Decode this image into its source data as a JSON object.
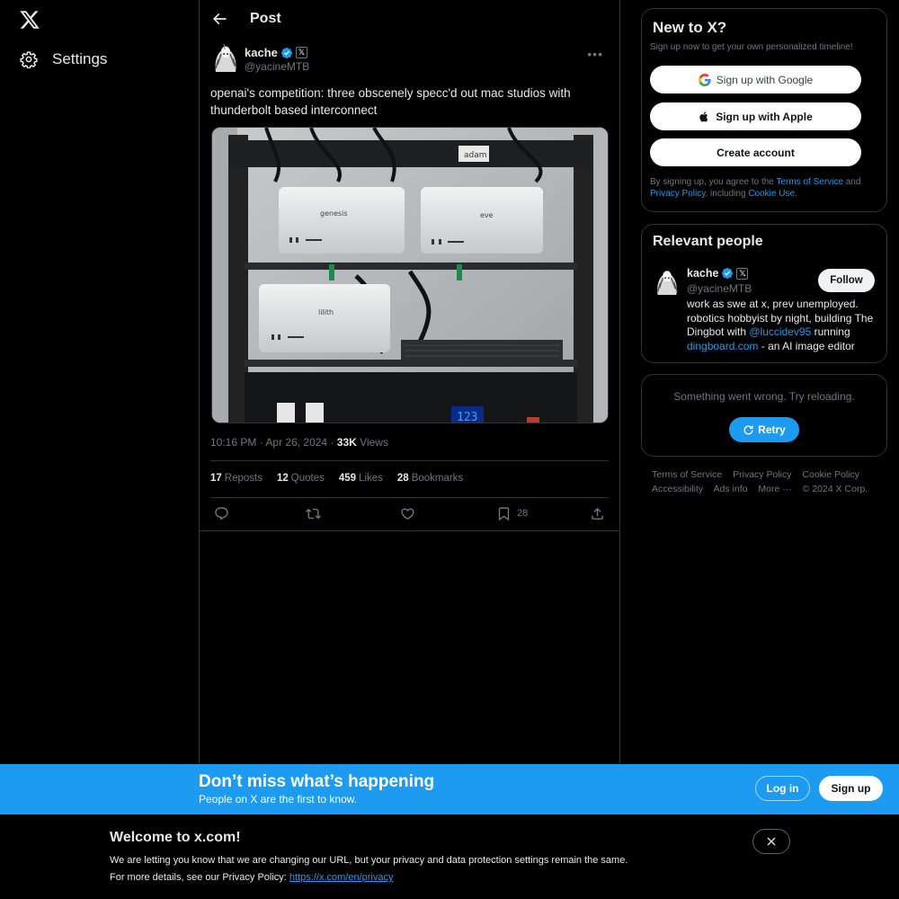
{
  "nav": {
    "logo_icon": "x-logo-icon",
    "settings_label": "Settings"
  },
  "header": {
    "title": "Post"
  },
  "post": {
    "author_name": "kache",
    "author_handle": "@yacineMTB",
    "author_badge": "𝕏",
    "text": "openai's competition: three obscenely specc'd out mac studios with thunderbolt based interconnect",
    "image_labels": [
      "adam",
      "genesis",
      "eve",
      "lilith"
    ],
    "image_display": "123",
    "time": "10:16 PM",
    "date": "Apr 26, 2024",
    "views_count": "33K",
    "views_label": "Views",
    "reposts_count": "17",
    "reposts_label": "Reposts",
    "quotes_count": "12",
    "quotes_label": "Quotes",
    "likes_count": "459",
    "likes_label": "Likes",
    "bookmarks_count": "28",
    "bookmarks_label": "Bookmarks",
    "bookmark_action_count": "28"
  },
  "signup_card": {
    "title": "New to X?",
    "subtitle": "Sign up now to get your own personalized timeline!",
    "google_label": "Sign up with Google",
    "apple_label": "Sign up with Apple",
    "create_label": "Create account",
    "legal_prefix": "By signing up, you agree to the",
    "terms": "Terms of Service",
    "and": "and",
    "privacy": "Privacy Policy",
    "including": ", including",
    "cookie": "Cookie Use",
    "period": "."
  },
  "relevant": {
    "title": "Relevant people",
    "name": "kache",
    "handle": "@yacineMTB",
    "follow_label": "Follow",
    "bio_1": "work as swe at x, prev unemployed. robotics hobbyist by night, building The Dingbot with",
    "bio_mention": "@luccidev95",
    "bio_2": "running",
    "bio_link": "dingboard.com",
    "bio_3": "- an AI image editor"
  },
  "error_card": {
    "message": "Something went wrong. Try reloading.",
    "retry_label": "Retry"
  },
  "footer": {
    "links": [
      "Terms of Service",
      "Privacy Policy",
      "Cookie Policy",
      "Accessibility",
      "Ads info",
      "More ···",
      "© 2024 X Corp."
    ]
  },
  "bottom_bar": {
    "title": "Don’t miss what’s happening",
    "subtitle": "People on X are the first to know.",
    "login_label": "Log in",
    "signup_label": "Sign up"
  },
  "cookie_banner": {
    "title": "Welcome to x.com!",
    "line1": "We are letting you know that we are changing our URL, but your privacy and data protection settings remain the same.",
    "line2_prefix": "For more details, see our Privacy Policy:",
    "link": "https://x.com/en/privacy"
  },
  "colors": {
    "accent": "#1d9bf0",
    "background": "#000000",
    "text_primary": "#e7e9ea",
    "text_secondary": "#71767b",
    "border": "#2f3336"
  }
}
